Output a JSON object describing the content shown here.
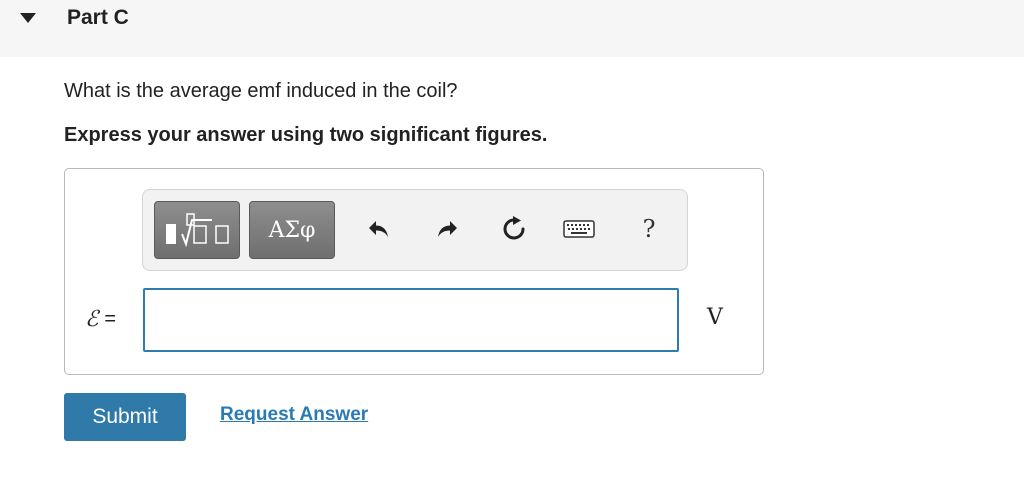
{
  "part": {
    "title": "Part C",
    "toggle_icon": "caret-down-icon"
  },
  "question": {
    "text": "What is the average emf induced in the coil?",
    "instruction": "Express your answer using two significant figures."
  },
  "toolbar": {
    "templates_icon": "math-templates-icon",
    "symbols_label": "ΑΣφ",
    "undo_icon": "undo-icon",
    "redo_icon": "redo-icon",
    "reset_icon": "reset-icon",
    "keyboard_icon": "keyboard-icon",
    "help_label": "?"
  },
  "answer": {
    "variable_symbol": "ℰ",
    "equals": "=",
    "value": "",
    "unit": "V"
  },
  "actions": {
    "submit_label": "Submit",
    "request_answer_label": "Request Answer"
  },
  "colors": {
    "header_bg": "#f6f6f6",
    "input_border": "#2f7cb2",
    "submit_bg": "#2f7aa8",
    "link": "#2a7ab3",
    "toolbar_button": "#7d7d7d"
  }
}
